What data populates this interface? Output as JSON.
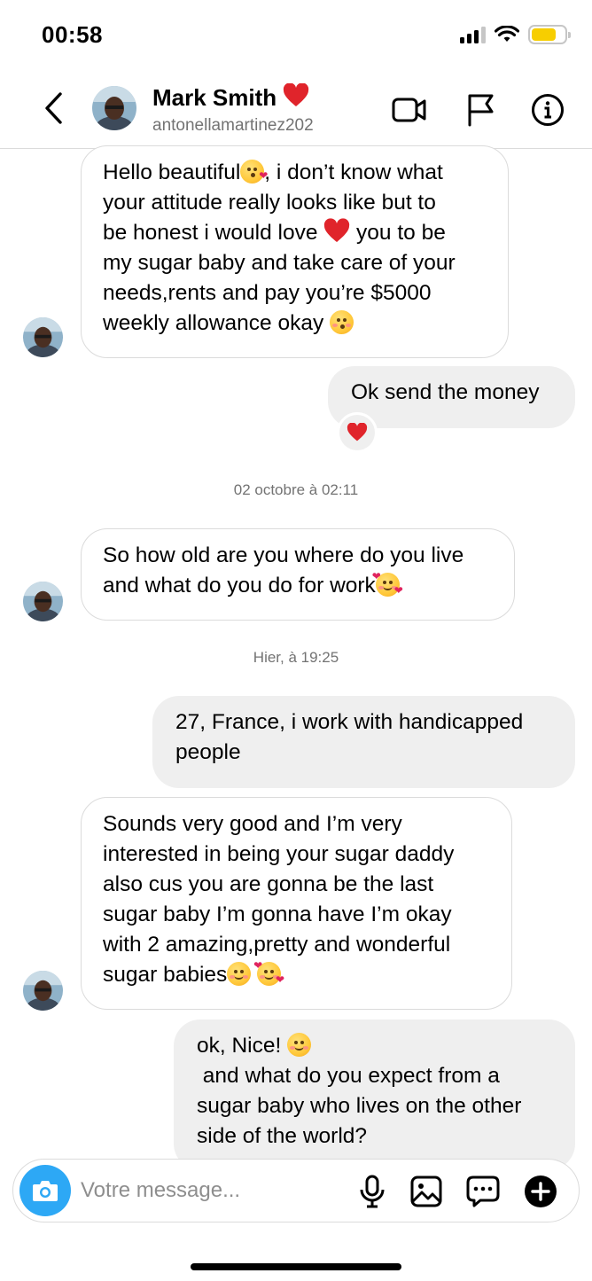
{
  "status_bar": {
    "time": "00:58",
    "battery_level": 0.75,
    "battery_color": "#f7ce00"
  },
  "header": {
    "name": "Mark Smith",
    "name_emoji": "red-heart",
    "username": "antonellamartinez202",
    "icons": [
      "back-chevron-icon",
      "video-camera-icon",
      "flag-icon",
      "info-icon"
    ]
  },
  "messages": [
    {
      "direction": "incoming",
      "text_parts": [
        "Hello beautiful",
        "kissing-face-emoji",
        ", i don’t know what your attitude really looks like but to be honest i would love ",
        "red-heart-emoji",
        " you to be my sugar baby and take care of your needs,rents and pay you’re $5000 weekly allowance okay ",
        "kissing-smiling-eyes-emoji"
      ],
      "lines": [
        "Hello beautiful",
        ", i don’t know what",
        "your attitude really looks like but to",
        "be honest i would love ",
        " you to be",
        "my sugar baby and take care of your",
        "needs,rents and pay you’re $5000",
        "weekly allowance okay "
      ]
    },
    {
      "direction": "outgoing",
      "text": "Ok send the money",
      "reaction": "red-heart-emoji"
    },
    {
      "type": "timestamp",
      "text": "02 octobre à 02:11"
    },
    {
      "direction": "incoming",
      "lines": [
        "So how old are you where do you live",
        "and what do you do for work"
      ],
      "emoji": "smiling-face-with-hearts-emoji"
    },
    {
      "type": "timestamp",
      "text": "Hier, à 19:25"
    },
    {
      "direction": "outgoing",
      "lines": [
        "27, France, i work with handicapped",
        "people"
      ]
    },
    {
      "direction": "incoming",
      "lines": [
        "Sounds very good and I’m very",
        "interested in being your sugar daddy",
        "also cus you are gonna be the last",
        "sugar baby I’m gonna have I’m okay",
        "with 2 amazing,pretty and wonderful",
        "sugar babies"
      ],
      "emojis": [
        "smiling-face-emoji",
        "smiling-face-with-hearts-emoji"
      ]
    },
    {
      "direction": "outgoing",
      "lines": [
        "ok, Nice! ",
        " and what do you expect from a",
        "sugar baby who lives on the other",
        "side of the world?"
      ],
      "emoji": "smiling-face-emoji"
    }
  ],
  "composer": {
    "placeholder": "Votre message...",
    "icons": [
      "camera-icon",
      "microphone-icon",
      "gallery-icon",
      "sticker-chat-icon",
      "plus-circle-icon"
    ],
    "camera_color": "#2da8f5"
  }
}
